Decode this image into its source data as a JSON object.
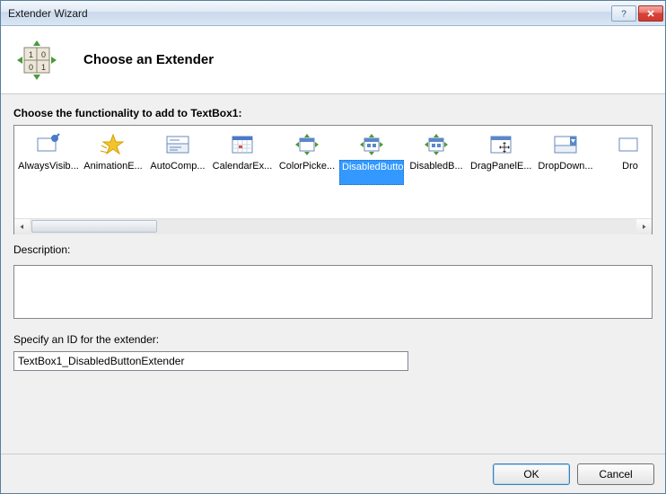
{
  "window": {
    "title": "Extender Wizard"
  },
  "header": {
    "title": "Choose an Extender"
  },
  "main": {
    "prompt": "Choose the functionality to add to TextBox1:",
    "items": [
      {
        "label": "AlwaysVisib...",
        "selected": false
      },
      {
        "label": "AnimationE...",
        "selected": false
      },
      {
        "label": "AutoComp...",
        "selected": false
      },
      {
        "label": "CalendarEx...",
        "selected": false
      },
      {
        "label": "ColorPicke...",
        "selected": false
      },
      {
        "label": "DisabledButtonExtender",
        "selected": true
      },
      {
        "label": "DisabledB...",
        "selected": false
      },
      {
        "label": "DragPanelE...",
        "selected": false
      },
      {
        "label": "DropDown...",
        "selected": false
      },
      {
        "label": "Dro",
        "selected": false
      }
    ],
    "description_label": "Description:",
    "description_text": "",
    "id_label": "Specify an ID for the extender:",
    "id_value": "TextBox1_DisabledButtonExtender"
  },
  "footer": {
    "ok": "OK",
    "cancel": "Cancel"
  }
}
